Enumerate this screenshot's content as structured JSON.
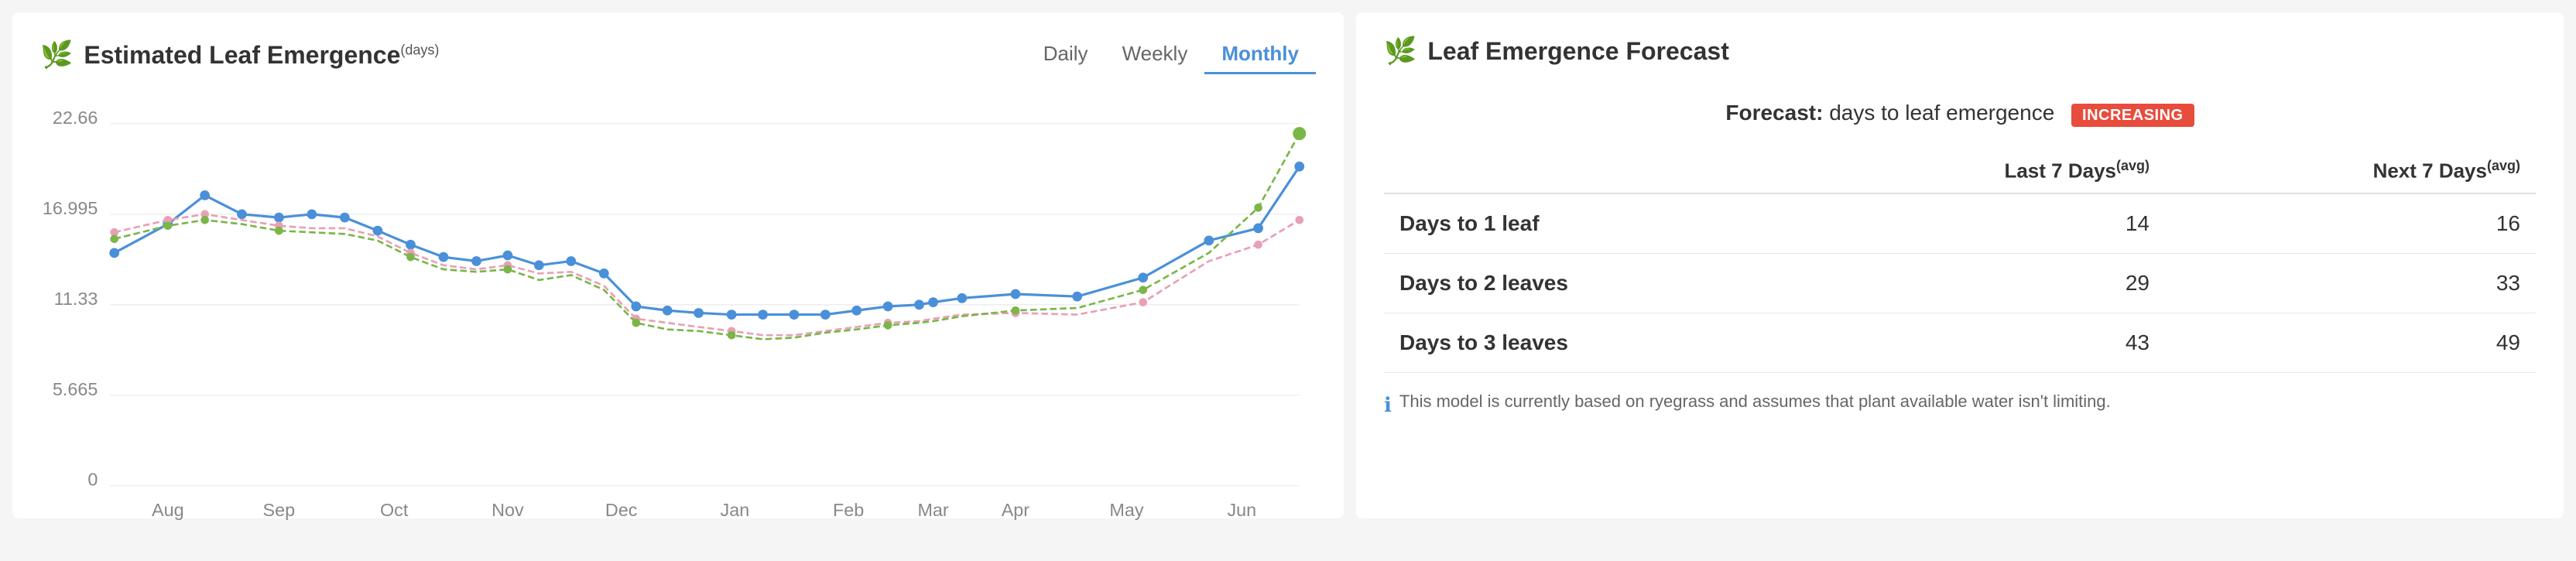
{
  "leftPanel": {
    "title": "Estimated Leaf Emergence",
    "titleSup": "(days)",
    "tabs": [
      {
        "label": "Daily",
        "active": false
      },
      {
        "label": "Weekly",
        "active": false
      },
      {
        "label": "Monthly",
        "active": true
      }
    ],
    "yAxis": {
      "labels": [
        "22.66",
        "16.995",
        "11.33",
        "5.665",
        "0"
      ]
    },
    "xAxis": {
      "labels": [
        "Aug",
        "Sep",
        "Oct",
        "Nov",
        "Dec",
        "Jan",
        "Feb",
        "Mar",
        "Apr",
        "May",
        "Jun"
      ]
    }
  },
  "rightPanel": {
    "title": "Leaf Emergence Forecast",
    "forecastLabel": "Forecast:",
    "forecastDesc": "days to leaf emergence",
    "badge": "INCREASING",
    "col1Header": "Last 7 Days",
    "col1HeaderSup": "(avg)",
    "col2Header": "Next 7 Days",
    "col2HeaderSup": "(avg)",
    "rows": [
      {
        "label": "Days to 1 leaf",
        "last7": "14",
        "next7": "16"
      },
      {
        "label": "Days to 2 leaves",
        "last7": "29",
        "next7": "33"
      },
      {
        "label": "Days to 3 leaves",
        "last7": "43",
        "next7": "49"
      }
    ],
    "note": "This model is currently based on ryegrass and assumes that plant available water isn't limiting."
  }
}
